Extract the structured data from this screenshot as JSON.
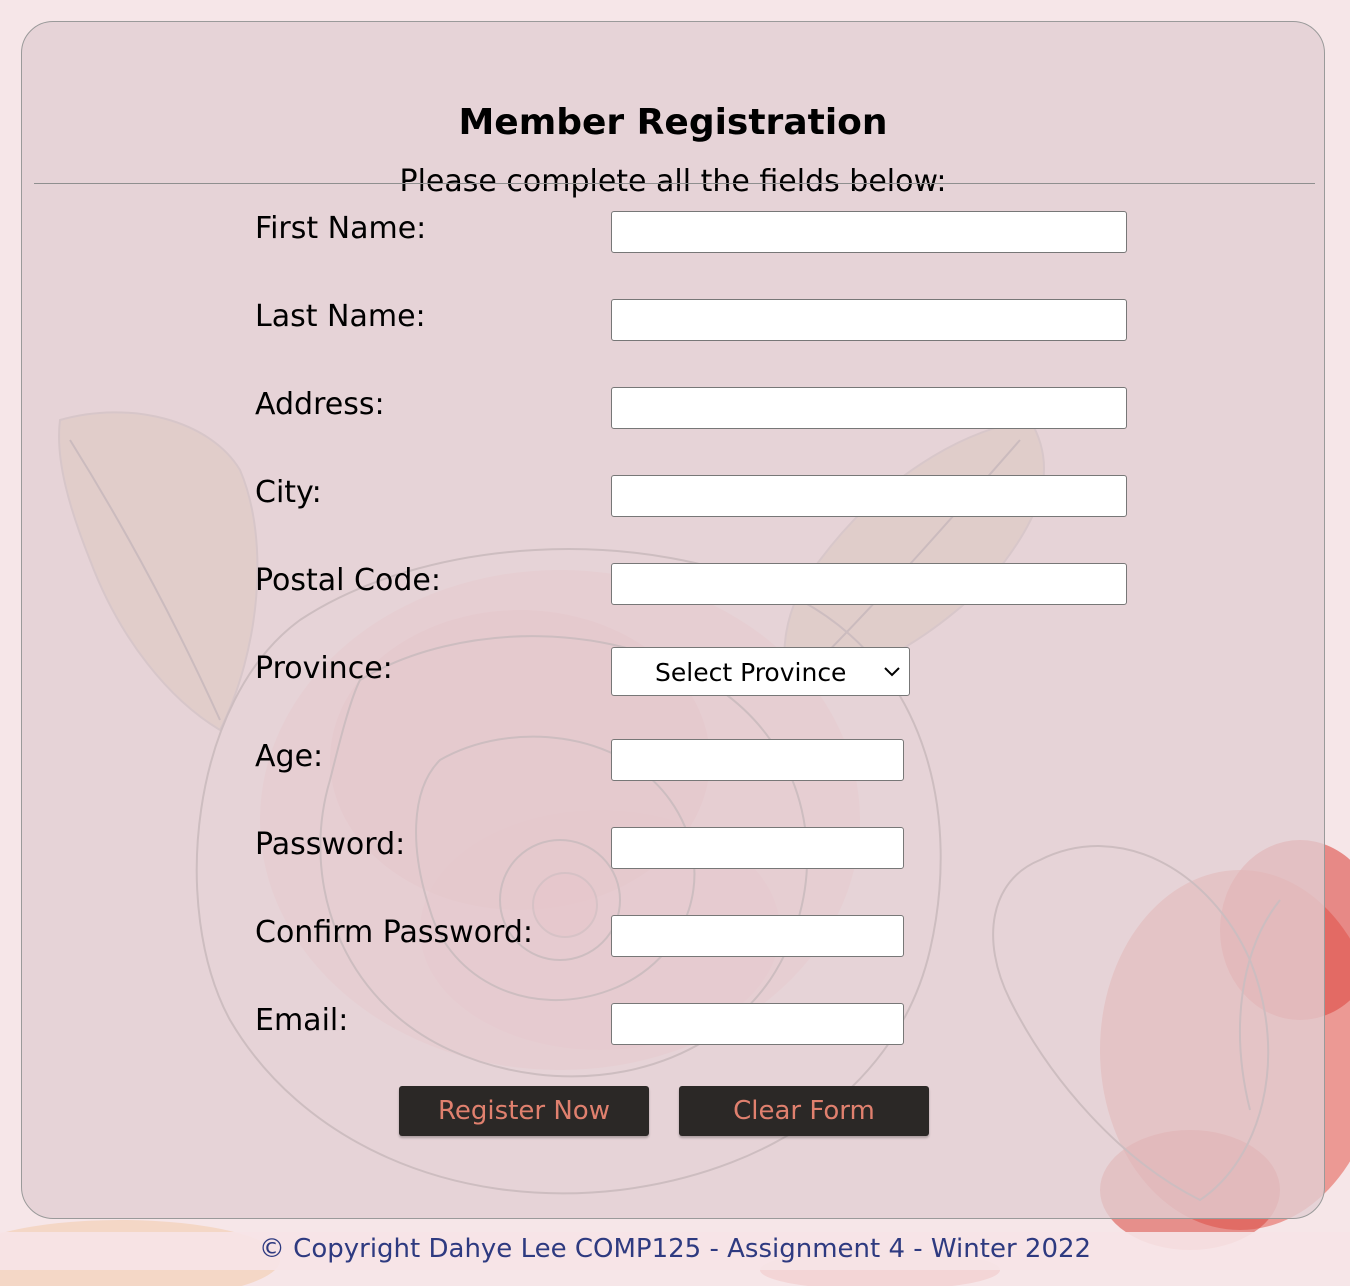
{
  "form": {
    "title": "Member Registration",
    "subtitle": "Please complete all the fields below:",
    "fields": [
      {
        "label": "First Name:",
        "value": ""
      },
      {
        "label": "Last Name:",
        "value": ""
      },
      {
        "label": "Address:",
        "value": ""
      },
      {
        "label": "City:",
        "value": ""
      },
      {
        "label": "Postal Code:",
        "value": ""
      },
      {
        "label": "Province:",
        "value": "Select Province"
      },
      {
        "label": "Age:",
        "value": ""
      },
      {
        "label": "Password:",
        "value": ""
      },
      {
        "label": "Confirm Password:",
        "value": ""
      },
      {
        "label": "Email:",
        "value": ""
      }
    ],
    "register_label": "Register Now",
    "clear_label": "Clear Form"
  },
  "footer": {
    "text": "© Copyright Dahye Lee COMP125 - Assignment 4 - Winter 2022"
  },
  "colors": {
    "card_background": "#e2ced2",
    "button_background": "#2b2826",
    "button_text": "#e0806e",
    "footer_text": "#2e3a80"
  },
  "icons": {
    "background": "rose-illustration",
    "select_arrow": "chevron-down-icon"
  }
}
